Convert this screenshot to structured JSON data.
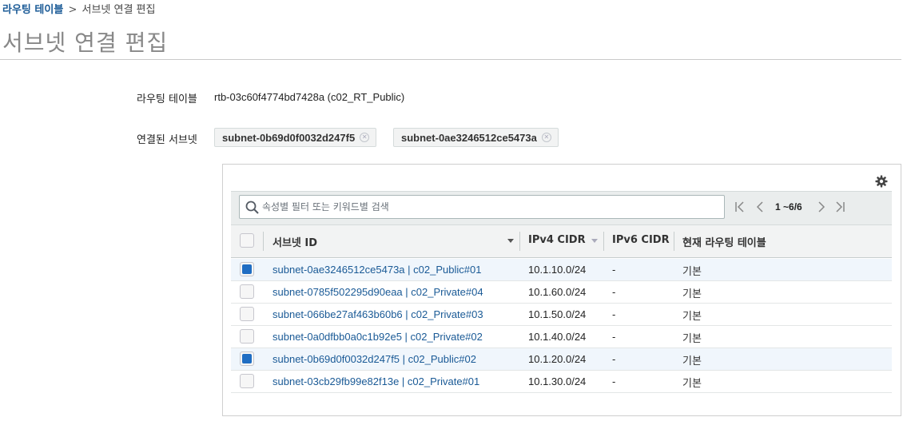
{
  "breadcrumb": {
    "parent": "라우팅 테이블",
    "separator": ">",
    "current": "서브넷 연결 편집"
  },
  "page_title": "서브넷 연결 편집",
  "route_table": {
    "label": "라우팅 테이블",
    "value": "rtb-03c60f4774bd7428a (c02_RT_Public)"
  },
  "associated_subnets": {
    "label": "연결된 서브넷",
    "tokens": [
      "subnet-0b69d0f0032d247f5",
      "subnet-0ae3246512ce5473a"
    ]
  },
  "search": {
    "placeholder": "속성별 필터 또는 키워드별 검색",
    "value": ""
  },
  "pagination": {
    "text": "1 ~6/6"
  },
  "table": {
    "columns": [
      "서브넷 ID",
      "IPv4 CIDR",
      "IPv6 CIDR",
      "현재 라우팅 테이블"
    ],
    "rows": [
      {
        "subnet": "subnet-0ae3246512ce5473a | c02_Public#01",
        "ipv4": "10.1.10.0/24",
        "ipv6": "-",
        "route_table": "기본",
        "checked": true
      },
      {
        "subnet": "subnet-0785f502295d90eaa | c02_Private#04",
        "ipv4": "10.1.60.0/24",
        "ipv6": "-",
        "route_table": "기본",
        "checked": false
      },
      {
        "subnet": "subnet-066be27af463b60b6 | c02_Private#03",
        "ipv4": "10.1.50.0/24",
        "ipv6": "-",
        "route_table": "기본",
        "checked": false
      },
      {
        "subnet": "subnet-0a0dfbb0a0c1b92e5 | c02_Private#02",
        "ipv4": "10.1.40.0/24",
        "ipv6": "-",
        "route_table": "기본",
        "checked": false
      },
      {
        "subnet": "subnet-0b69d0f0032d247f5 | c02_Public#02",
        "ipv4": "10.1.20.0/24",
        "ipv6": "-",
        "route_table": "기본",
        "checked": true
      },
      {
        "subnet": "subnet-03cb29fb99e82f13e | c02_Private#01",
        "ipv4": "10.1.30.0/24",
        "ipv6": "-",
        "route_table": "기본",
        "checked": false
      }
    ]
  },
  "colors": {
    "link": "#1a5a96",
    "checkbox_checked": "#1f6dc3",
    "selected_row": "#f0f6fc"
  }
}
